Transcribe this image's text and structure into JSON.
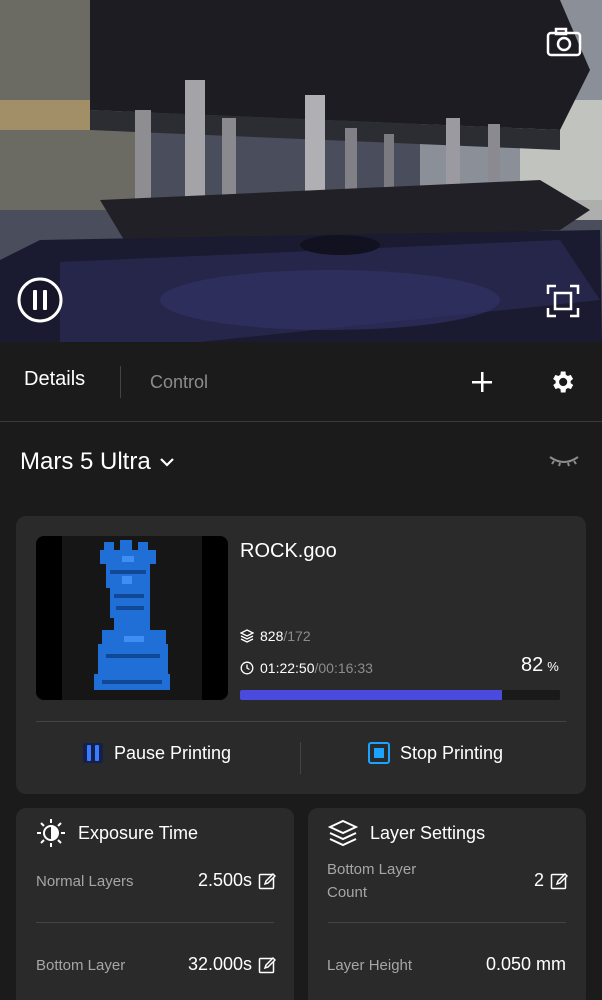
{
  "tabs": {
    "details": "Details",
    "control": "Control"
  },
  "printer": {
    "name": "Mars 5 Ultra"
  },
  "job": {
    "filename": "ROCK.goo",
    "layers_current": "828",
    "layers_total": "/172",
    "time_elapsed": "01:22:50",
    "time_remaining": "/00:16:33",
    "progress_percent": "82",
    "percent_sign": "%",
    "progress_fraction": 0.82,
    "pause_label": "Pause Printing",
    "stop_label": "Stop Printing"
  },
  "exposure": {
    "title": "Exposure Time",
    "normal_label": "Normal Layers",
    "normal_value": "2.500s",
    "bottom_label": "Bottom Layer",
    "bottom_value": "32.000s"
  },
  "layer_settings": {
    "title": "Layer Settings",
    "bottom_count_label_line1": "Bottom Layer",
    "bottom_count_label_line2": "Count",
    "bottom_count_value": "2",
    "height_label": "Layer Height",
    "height_value": "0.050 mm"
  },
  "colors": {
    "accent": "#4a4adf",
    "pause_icon": "#3b7bff",
    "stop_icon": "#1aa3ff",
    "model_blue": "#1f6fd6"
  },
  "icons": [
    "camera-icon",
    "pause-circle-icon",
    "fullscreen-icon",
    "plus-icon",
    "gear-icon",
    "chevron-down-icon",
    "eye-closed-icon",
    "layers-icon",
    "clock-icon",
    "brightness-icon",
    "edit-icon"
  ]
}
